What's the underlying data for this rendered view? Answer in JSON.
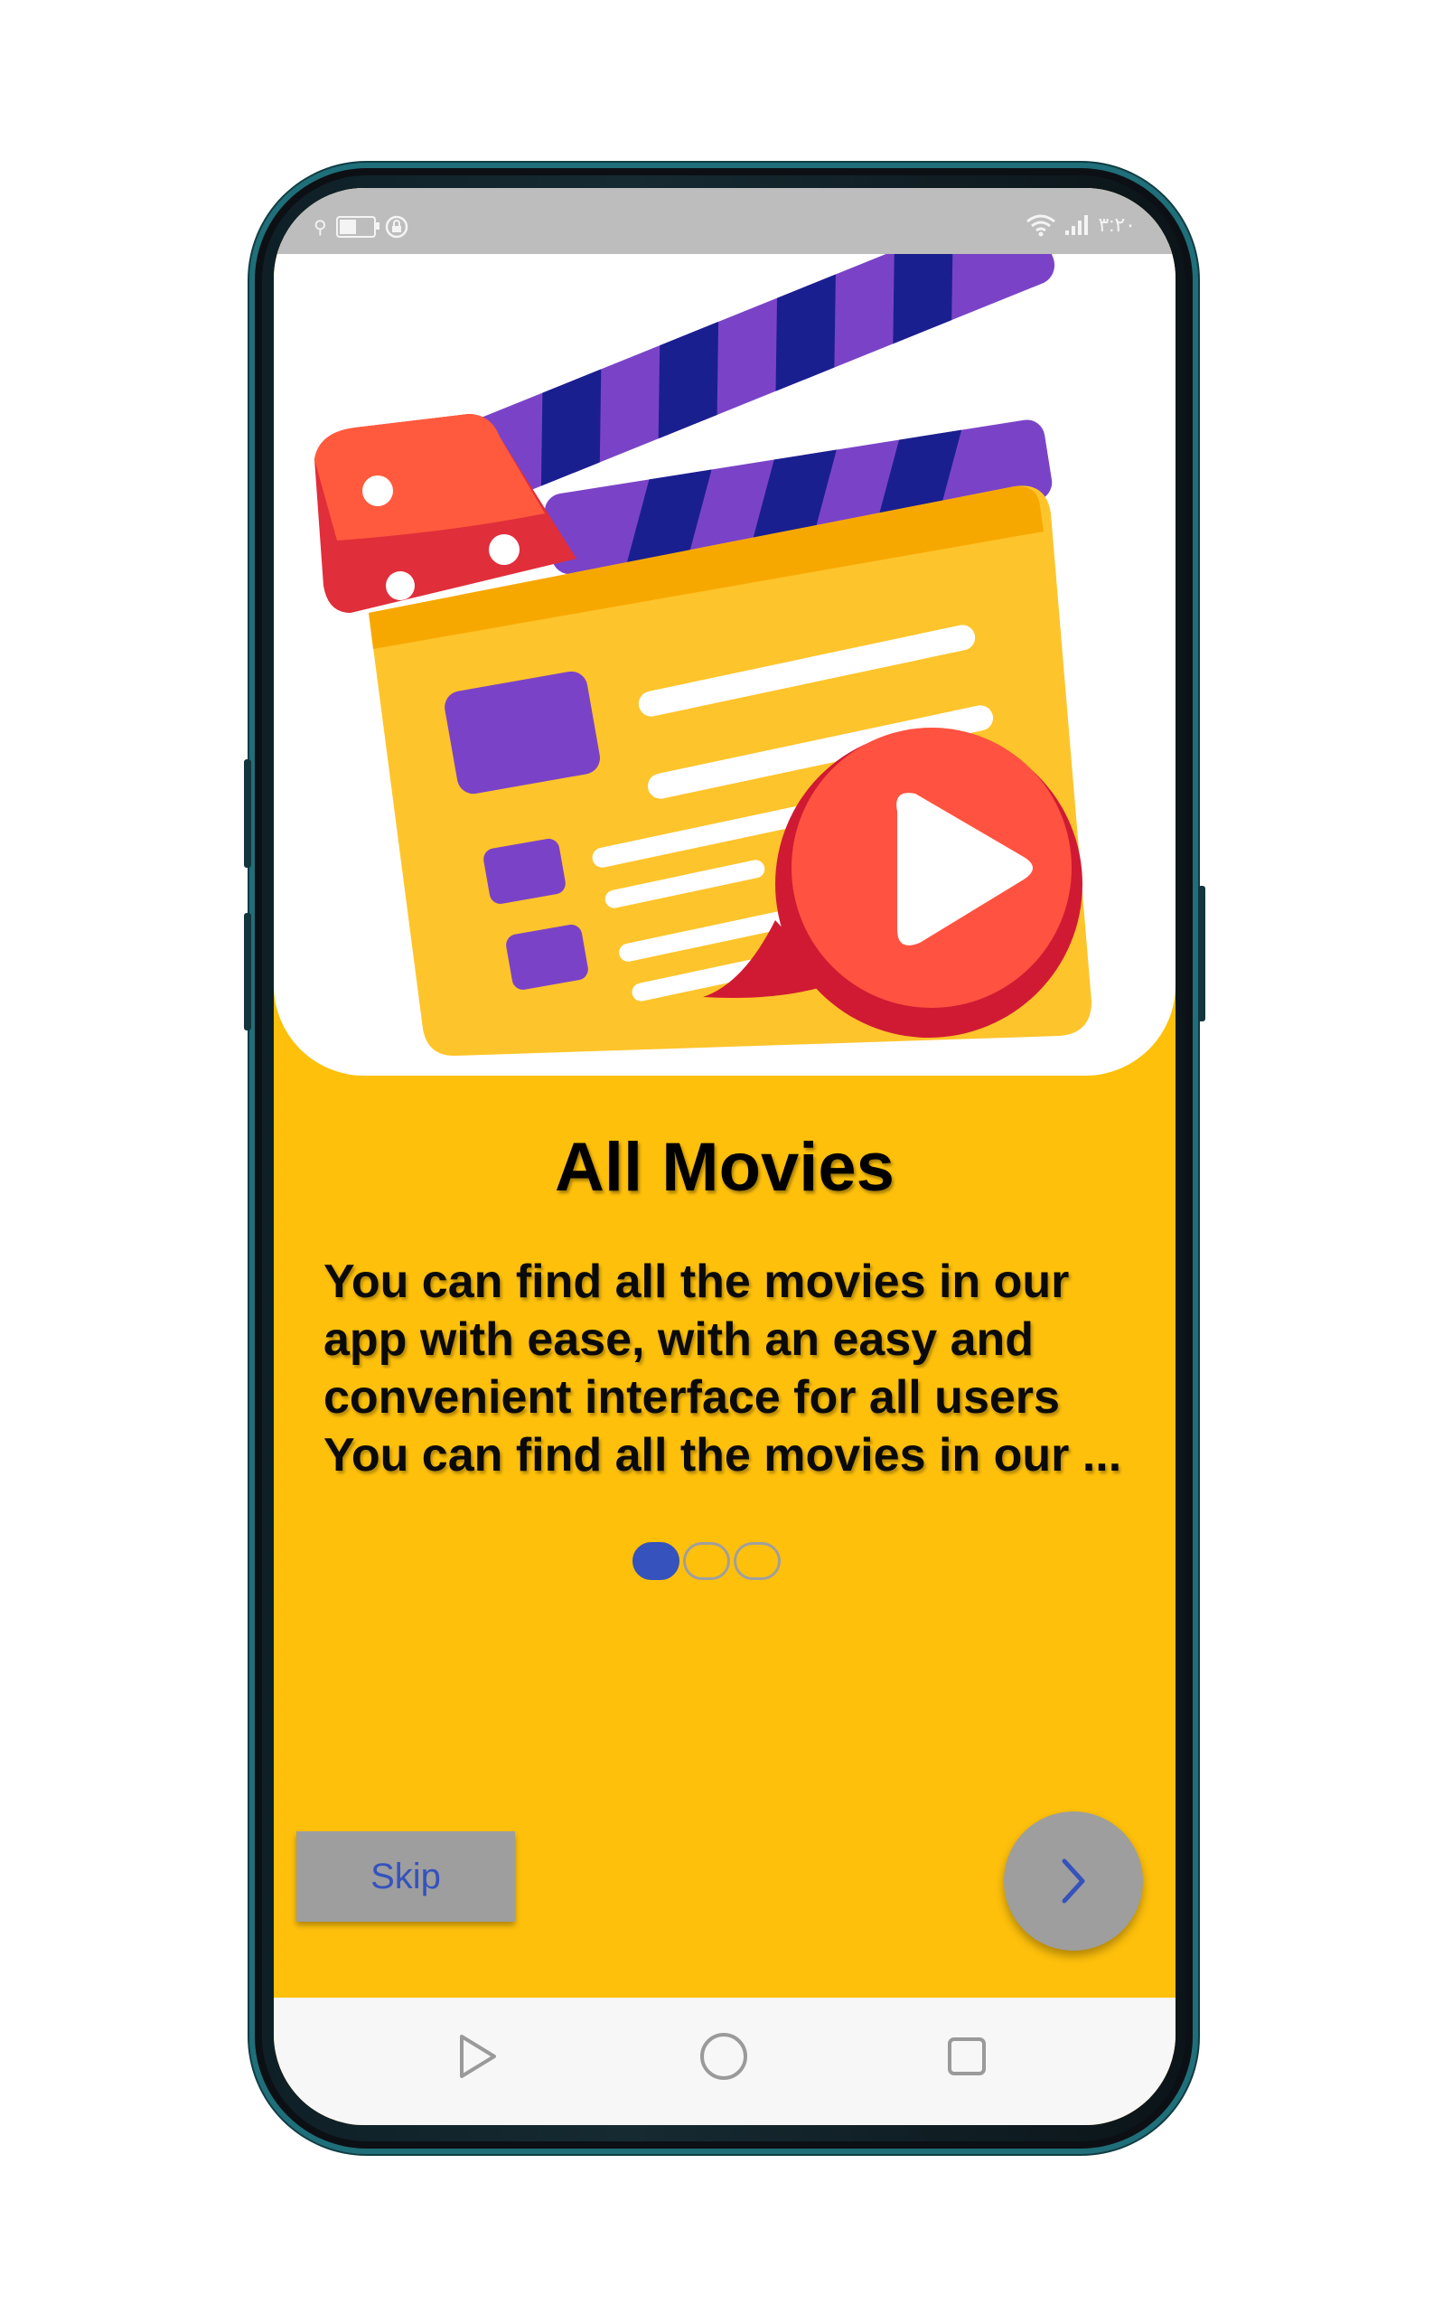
{
  "status_bar": {
    "time": "٣:٢٠"
  },
  "onboarding": {
    "title": "All Movies",
    "description_lines": [
      "You can find all the movies in our",
      "app with ease, with an easy and",
      "convenient interface for all users",
      "You can find all the movies in our ..."
    ],
    "page_indicator": {
      "current_page": 1,
      "total_pages": 3
    },
    "skip_label": "Skip"
  },
  "icons": {
    "illustration": "clapperboard-play-illustration-icon",
    "next": "chevron-right-icon",
    "nav_back": "triangle-back-icon",
    "nav_home": "circle-home-icon",
    "nav_recents": "square-recents-icon"
  },
  "colors": {
    "background": "#fec00b",
    "accent": "#3552bd",
    "button": "#9e9e9e",
    "status_bar": "#bdbdbd"
  }
}
